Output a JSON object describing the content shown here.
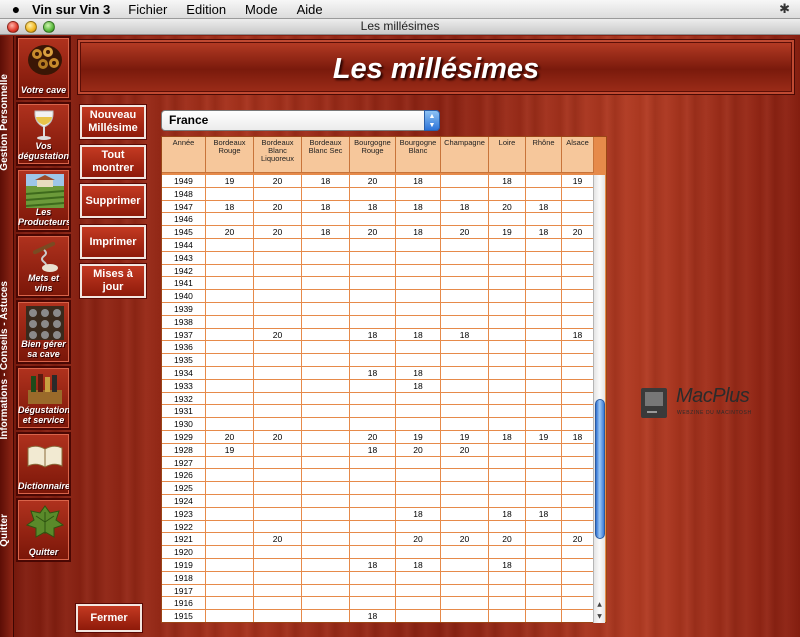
{
  "menubar": {
    "app_name": "Vin sur Vin 3",
    "menus": [
      "Fichier",
      "Edition",
      "Mode",
      "Aide"
    ]
  },
  "window": {
    "title": "Les millésimes"
  },
  "left_rail": {
    "sections": [
      "Gestion Personnelle",
      "Informations - Conseils - Astuces",
      "Quitter"
    ]
  },
  "nav": {
    "items": [
      {
        "label": "Votre cave",
        "icon": "wine-bottles-icon"
      },
      {
        "label": "Vos dégustations",
        "icon": "wine-glass-icon"
      },
      {
        "label": "Les Producteurs",
        "icon": "vineyard-icon"
      },
      {
        "label": "Mets et vins",
        "icon": "corkscrew-icon"
      },
      {
        "label": "Bien gérer sa cave",
        "icon": "wine-rack-icon"
      },
      {
        "label": "Dégustation et service",
        "icon": "bottles-crate-icon"
      },
      {
        "label": "Dictionnaire",
        "icon": "book-icon"
      },
      {
        "label": "Quitter",
        "icon": "grape-leaf-icon"
      }
    ]
  },
  "header": {
    "title": "Les millésimes"
  },
  "actions": {
    "new_vintage": "Nouveau Millésime",
    "show_all": "Tout montrer",
    "delete": "Supprimer",
    "print": "Imprimer",
    "updates": "Mises à jour",
    "close": "Fermer"
  },
  "country_select": {
    "value": "France"
  },
  "table": {
    "columns": [
      "Année",
      "Bordeaux Rouge",
      "Bordeaux Blanc Liquoreux",
      "Bordeaux Blanc Sec",
      "Bourgogne Rouge",
      "Bourgogne Blanc",
      "Champagne",
      "Loire",
      "Rhône",
      "Alsace"
    ],
    "rows": [
      [
        "1949",
        "19",
        "20",
        "18",
        "20",
        "18",
        "",
        "18",
        "",
        "19"
      ],
      [
        "1948",
        "",
        "",
        "",
        "",
        "",
        "",
        "",
        "",
        ""
      ],
      [
        "1947",
        "18",
        "20",
        "18",
        "18",
        "18",
        "18",
        "20",
        "18",
        ""
      ],
      [
        "1946",
        "",
        "",
        "",
        "",
        "",
        "",
        "",
        "",
        ""
      ],
      [
        "1945",
        "20",
        "20",
        "18",
        "20",
        "18",
        "20",
        "19",
        "18",
        "20"
      ],
      [
        "1944",
        "",
        "",
        "",
        "",
        "",
        "",
        "",
        "",
        ""
      ],
      [
        "1943",
        "",
        "",
        "",
        "",
        "",
        "",
        "",
        "",
        ""
      ],
      [
        "1942",
        "",
        "",
        "",
        "",
        "",
        "",
        "",
        "",
        ""
      ],
      [
        "1941",
        "",
        "",
        "",
        "",
        "",
        "",
        "",
        "",
        ""
      ],
      [
        "1940",
        "",
        "",
        "",
        "",
        "",
        "",
        "",
        "",
        ""
      ],
      [
        "1939",
        "",
        "",
        "",
        "",
        "",
        "",
        "",
        "",
        ""
      ],
      [
        "1938",
        "",
        "",
        "",
        "",
        "",
        "",
        "",
        "",
        ""
      ],
      [
        "1937",
        "",
        "20",
        "",
        "18",
        "18",
        "18",
        "",
        "",
        "18"
      ],
      [
        "1936",
        "",
        "",
        "",
        "",
        "",
        "",
        "",
        "",
        ""
      ],
      [
        "1935",
        "",
        "",
        "",
        "",
        "",
        "",
        "",
        "",
        ""
      ],
      [
        "1934",
        "",
        "",
        "",
        "18",
        "18",
        "",
        "",
        "",
        ""
      ],
      [
        "1933",
        "",
        "",
        "",
        "",
        "18",
        "",
        "",
        "",
        ""
      ],
      [
        "1932",
        "",
        "",
        "",
        "",
        "",
        "",
        "",
        "",
        ""
      ],
      [
        "1931",
        "",
        "",
        "",
        "",
        "",
        "",
        "",
        "",
        ""
      ],
      [
        "1930",
        "",
        "",
        "",
        "",
        "",
        "",
        "",
        "",
        ""
      ],
      [
        "1929",
        "20",
        "20",
        "",
        "20",
        "19",
        "19",
        "18",
        "19",
        "18"
      ],
      [
        "1928",
        "19",
        "",
        "",
        "18",
        "20",
        "20",
        "",
        "",
        ""
      ],
      [
        "1927",
        "",
        "",
        "",
        "",
        "",
        "",
        "",
        "",
        ""
      ],
      [
        "1926",
        "",
        "",
        "",
        "",
        "",
        "",
        "",
        "",
        ""
      ],
      [
        "1925",
        "",
        "",
        "",
        "",
        "",
        "",
        "",
        "",
        ""
      ],
      [
        "1924",
        "",
        "",
        "",
        "",
        "",
        "",
        "",
        "",
        ""
      ],
      [
        "1923",
        "",
        "",
        "",
        "",
        "18",
        "",
        "18",
        "18",
        ""
      ],
      [
        "1922",
        "",
        "",
        "",
        "",
        "",
        "",
        "",
        "",
        ""
      ],
      [
        "1921",
        "",
        "20",
        "",
        "",
        "20",
        "20",
        "20",
        "",
        "20"
      ],
      [
        "1920",
        "",
        "",
        "",
        "",
        "",
        "",
        "",
        "",
        ""
      ],
      [
        "1919",
        "",
        "",
        "",
        "18",
        "18",
        "",
        "18",
        "",
        ""
      ],
      [
        "1918",
        "",
        "",
        "",
        "",
        "",
        "",
        "",
        "",
        ""
      ],
      [
        "1917",
        "",
        "",
        "",
        "",
        "",
        "",
        "",
        "",
        ""
      ],
      [
        "1916",
        "",
        "",
        "",
        "",
        "",
        "",
        "",
        "",
        ""
      ],
      [
        "1915",
        "",
        "",
        "",
        "18",
        "",
        "",
        "",
        "",
        ""
      ]
    ]
  },
  "brand": {
    "name": "MacPlus",
    "tagline": "WEBZINE DU MACINTOSH"
  }
}
